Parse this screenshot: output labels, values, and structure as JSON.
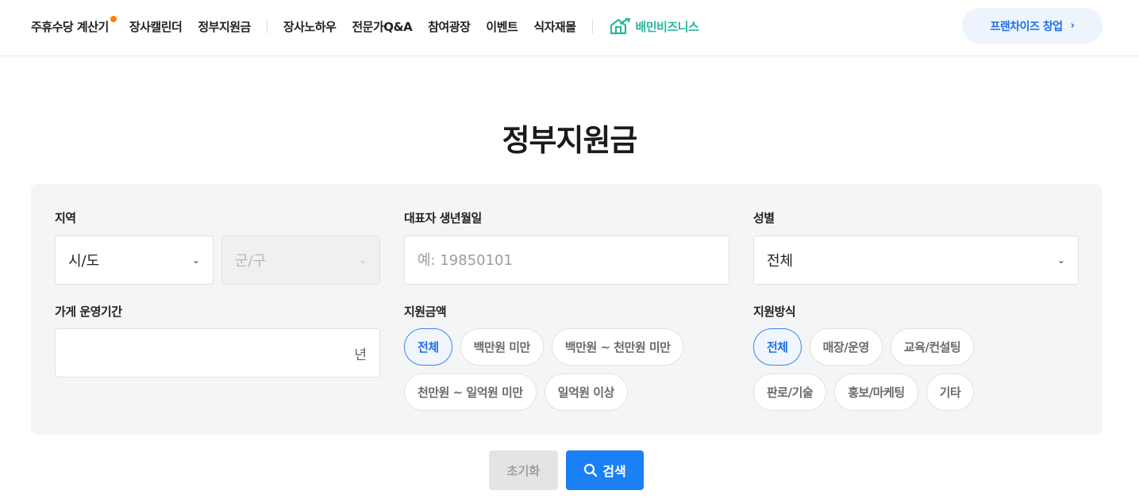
{
  "nav": {
    "items": [
      {
        "label": "주휴수당 계산기",
        "dot": true
      },
      {
        "label": "장사캘린더"
      },
      {
        "label": "정부지원금"
      }
    ],
    "items2": [
      {
        "label": "장사노하우"
      },
      {
        "label": "전문가Q&A"
      },
      {
        "label": "참여광장"
      },
      {
        "label": "이벤트"
      },
      {
        "label": "식자재몰"
      }
    ],
    "brand_label": "배민비즈니스",
    "brand_color": "#27b89c",
    "franchise_label": "프랜차이즈 창업",
    "franchise_icon": "chevron-right-icon"
  },
  "page": {
    "title": "정부지원금"
  },
  "filters": {
    "region": {
      "label": "지역",
      "city_value": "시/도",
      "district_value": "군/구"
    },
    "birth": {
      "label": "대표자 생년월일",
      "placeholder": "예: 19850101"
    },
    "gender": {
      "label": "성별",
      "value": "전체"
    },
    "period": {
      "label": "가게 운영기간",
      "unit": "년"
    },
    "amount": {
      "label": "지원금액",
      "options": [
        "전체",
        "백만원 미만",
        "백만원 ~ 천만원 미만",
        "천만원 ~ 일억원 미만",
        "일억원 이상"
      ],
      "selected": "전체"
    },
    "method": {
      "label": "지원방식",
      "options": [
        "전체",
        "매장/운영",
        "교육/컨설팅",
        "판로/기술",
        "홍보/마케팅",
        "기타"
      ],
      "selected": "전체"
    }
  },
  "actions": {
    "reset_label": "초기화",
    "search_label": "검색"
  },
  "colors": {
    "accent": "#1b7ff5",
    "dot": "#ff7e00",
    "panel_bg": "#f4f5f7"
  }
}
